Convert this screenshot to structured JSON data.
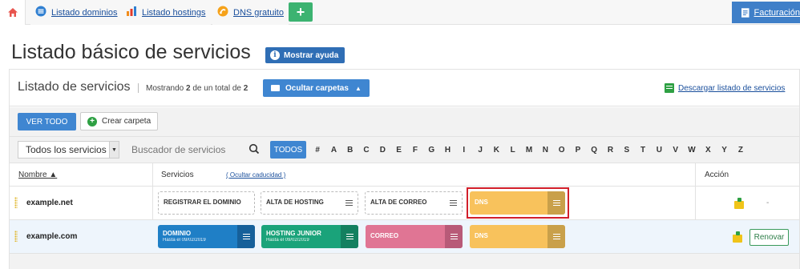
{
  "topnav": {
    "home_icon": "home-icon",
    "tabs": [
      {
        "label": "Listado dominios",
        "icon": "globe-icon"
      },
      {
        "label": "Listado hostings",
        "icon": "bar-chart-icon"
      },
      {
        "label": "DNS gratuito",
        "icon": "dns-icon"
      }
    ],
    "add_label": "+",
    "billing_label": "Facturación"
  },
  "page": {
    "title": "Listado básico de servicios",
    "help_label": "Mostrar ayuda",
    "help_icon_glyph": "i"
  },
  "panel": {
    "title": "Listado de servicios",
    "count_prefix": "Mostrando",
    "count_shown": "2",
    "count_middle": "de un total de",
    "count_total": "2",
    "folders_label": "Ocultar carpetas",
    "folders_caret": "▲",
    "download_label": "Descargar listado de servicios"
  },
  "toolbar": {
    "ver_todo": "VER TODO",
    "crear_carpeta": "Crear carpeta",
    "crear_icon_glyph": "+"
  },
  "filters": {
    "select_value": "Todos los servicios",
    "select_arrow": "▼",
    "search_placeholder": "Buscador de servicios",
    "todos": "TODOS",
    "letters": [
      "#",
      "A",
      "B",
      "C",
      "D",
      "E",
      "F",
      "G",
      "H",
      "I",
      "J",
      "K",
      "L",
      "M",
      "N",
      "O",
      "P",
      "Q",
      "R",
      "S",
      "T",
      "U",
      "V",
      "W",
      "X",
      "Y",
      "Z"
    ]
  },
  "table": {
    "col_nombre": "Nombre ▲",
    "col_servicios": "Servicios",
    "col_ocultar": "( Ocultar caducidad )",
    "col_accion": "Acción"
  },
  "rows": [
    {
      "domain": "example.net",
      "services": [
        {
          "label": "REGISTRAR EL DOMINIO",
          "style": "dashed"
        },
        {
          "label": "ALTA DE HOSTING",
          "style": "dashed"
        },
        {
          "label": "ALTA DE CORREO",
          "style": "dashed"
        },
        {
          "label": "DNS",
          "style": "solid",
          "color": "#f8c25c"
        }
      ],
      "action_dash": "-"
    },
    {
      "domain": "example.com",
      "services": [
        {
          "label": "DOMINIO",
          "sub": "Hasta el 09/02/2019",
          "color": "#1f7fc6"
        },
        {
          "label": "HOSTING JUNIOR",
          "sub": "Hasta el 09/02/2019",
          "color": "#1aa37a"
        },
        {
          "label": "CORREO",
          "color": "#e07594"
        },
        {
          "label": "DNS",
          "color": "#f8c25c"
        }
      ],
      "renovar": "Renovar"
    }
  ],
  "colors": {
    "primary": "#3f86d1",
    "highlight": "#d21f2a",
    "green": "#2ea043"
  }
}
